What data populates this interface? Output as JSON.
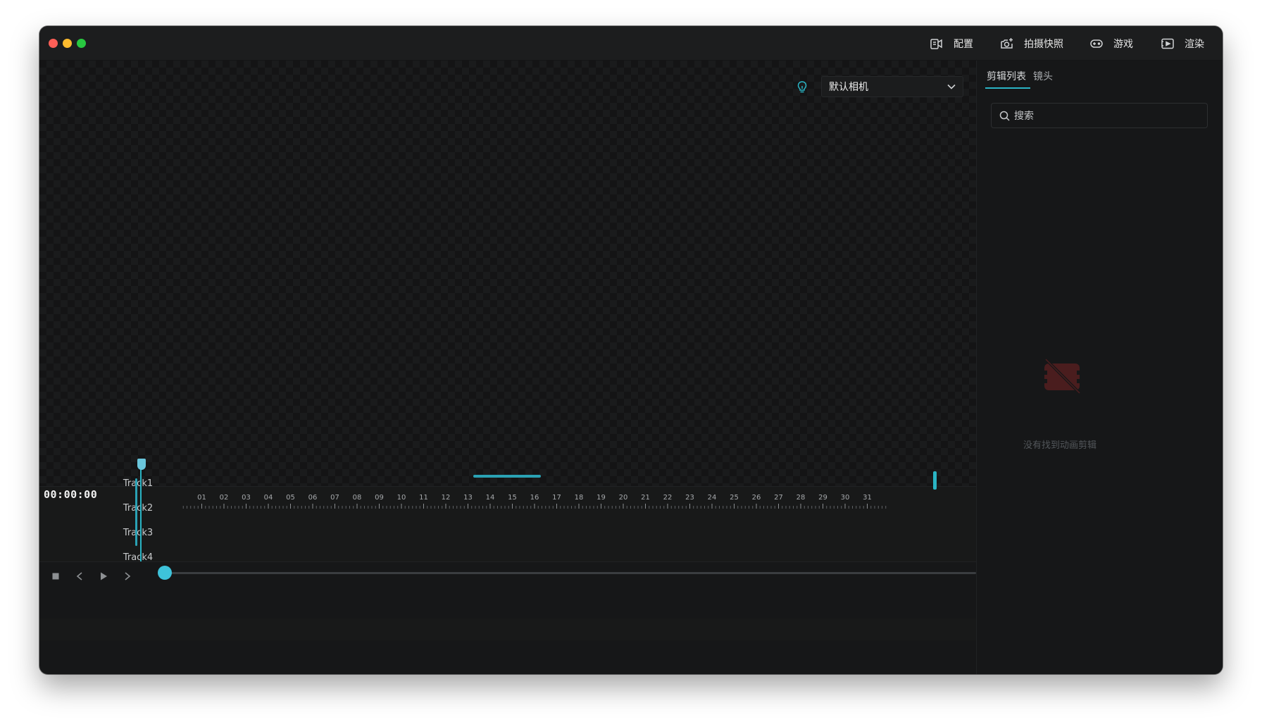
{
  "toolbar": {
    "config_label": "配置",
    "snapshot_label": "拍摄快照",
    "game_label": "游戏",
    "render_label": "渲染"
  },
  "viewport": {
    "camera_selected": "默认相机"
  },
  "right_panel": {
    "tabs": [
      {
        "label": "剪辑列表",
        "active": true
      },
      {
        "label": "镜头",
        "active": false
      }
    ],
    "search_placeholder": "搜索",
    "empty_message": "没有找到动画剪辑"
  },
  "timeline": {
    "timecode": "00:00:00",
    "ticks": [
      "01",
      "02",
      "03",
      "04",
      "05",
      "06",
      "07",
      "08",
      "09",
      "10",
      "11",
      "12",
      "13",
      "14",
      "15",
      "16",
      "17",
      "18",
      "19",
      "20",
      "21",
      "22",
      "23",
      "24",
      "25",
      "26",
      "27",
      "28",
      "29",
      "30",
      "31"
    ],
    "tracks": [
      "Track1",
      "Track2",
      "Track3",
      "Track4"
    ]
  },
  "colors": {
    "accent": "#2ab4c4",
    "window_bg": "#161718",
    "empty_icon": "#5a2222"
  },
  "icons": {
    "config": "video-config-icon",
    "snapshot": "camera-snapshot-icon",
    "game": "gamepad-icon",
    "render": "render-play-icon",
    "bulb": "lightbulb-icon",
    "dropdown": "chevron-down-icon",
    "search": "search-icon",
    "empty": "no-clip-icon",
    "stop": "stop-icon",
    "prev": "prev-icon",
    "play": "play-icon",
    "next": "next-icon"
  }
}
